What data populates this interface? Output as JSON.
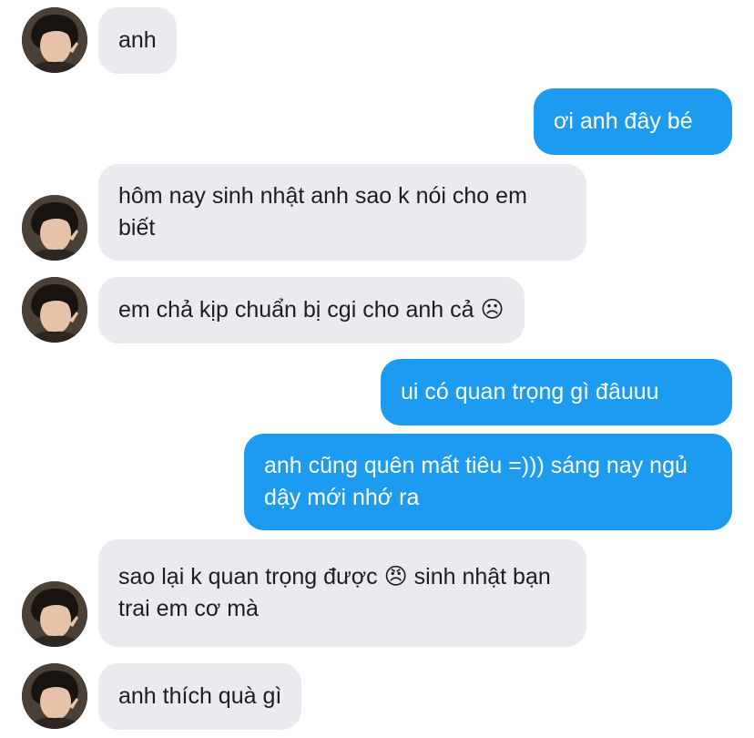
{
  "conversation": {
    "messages": [
      {
        "sender": "them",
        "text": "anh"
      },
      {
        "sender": "me",
        "text": "ơi anh đây bé"
      },
      {
        "sender": "them",
        "text": "hôm nay sinh nhật anh sao k nói cho em biết"
      },
      {
        "sender": "them",
        "text": "em chả kịp chuẩn bị cgi cho anh cả ☹"
      },
      {
        "sender": "me",
        "text": "ui có quan trọng gì đâuuu"
      },
      {
        "sender": "me",
        "text": "anh cũng quên mất tiêu =))) sáng nay ngủ dậy mới nhớ ra"
      },
      {
        "sender": "them",
        "text": "sao lại k quan trọng được 😠 sinh nhật bạn trai em cơ mà"
      },
      {
        "sender": "them",
        "text": "anh thích quà gì"
      }
    ]
  },
  "theme": {
    "incoming_bubble": "#e9ebee",
    "outgoing_bubble": "#1d9bf0",
    "incoming_text": "#1c1e21",
    "outgoing_text": "#ffffff"
  },
  "avatar": {
    "icon": "profile-photo-avatar"
  }
}
